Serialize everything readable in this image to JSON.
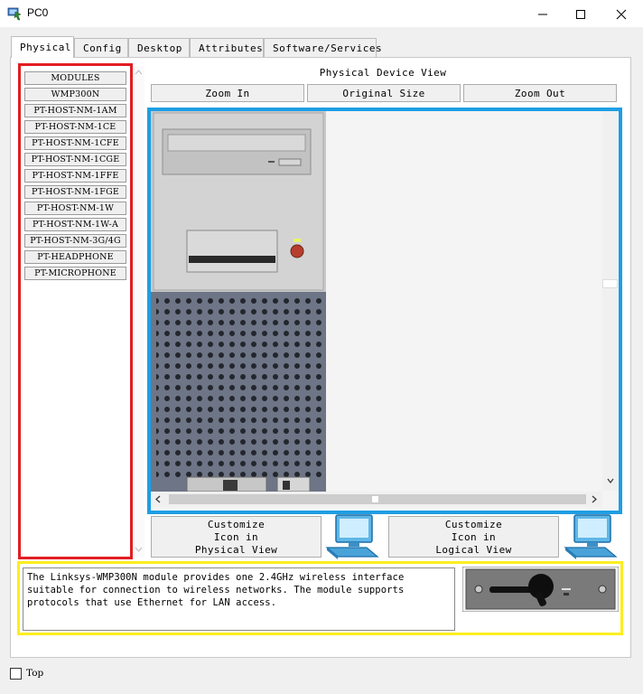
{
  "window": {
    "title": "PC0",
    "minimize_glyph": "—",
    "maximize_glyph": "☐",
    "close_glyph": "✕"
  },
  "tabs": [
    {
      "label": "Physical",
      "active": true
    },
    {
      "label": "Config",
      "active": false
    },
    {
      "label": "Desktop",
      "active": false
    },
    {
      "label": "Attributes",
      "active": false
    },
    {
      "label": "Software/Services",
      "active": false
    }
  ],
  "modules": {
    "items": [
      "MODULES",
      "WMP300N",
      "PT-HOST-NM-1AM",
      "PT-HOST-NM-1CE",
      "PT-HOST-NM-1CFE",
      "PT-HOST-NM-1CGE",
      "PT-HOST-NM-1FFE",
      "PT-HOST-NM-1FGE",
      "PT-HOST-NM-1W",
      "PT-HOST-NM-1W-A",
      "PT-HOST-NM-3G/4G",
      "PT-HEADPHONE",
      "PT-MICROPHONE"
    ],
    "highlight_color": "#e21d22"
  },
  "physical_view": {
    "title": "Physical Device View",
    "zoom_in": "Zoom In",
    "original_size": "Original Size",
    "zoom_out": "Zoom Out",
    "highlight_color": "#1e9ee3"
  },
  "customize": {
    "physical": {
      "line1": "Customize",
      "line2": "Icon in",
      "line3": "Physical View"
    },
    "logical": {
      "line1": "Customize",
      "line2": "Icon in",
      "line3": "Logical View"
    }
  },
  "description": {
    "text": "The Linksys-WMP300N module provides one 2.4GHz wireless interface suitable for connection to wireless networks. The module supports protocols that use Ethernet for LAN access.",
    "highlight_color": "#fcee21"
  },
  "footer": {
    "top_label": "Top"
  },
  "icons": {
    "app": "packet-tracer-icon",
    "computer": "computer-icon",
    "module": "wmp300n-module-icon"
  }
}
